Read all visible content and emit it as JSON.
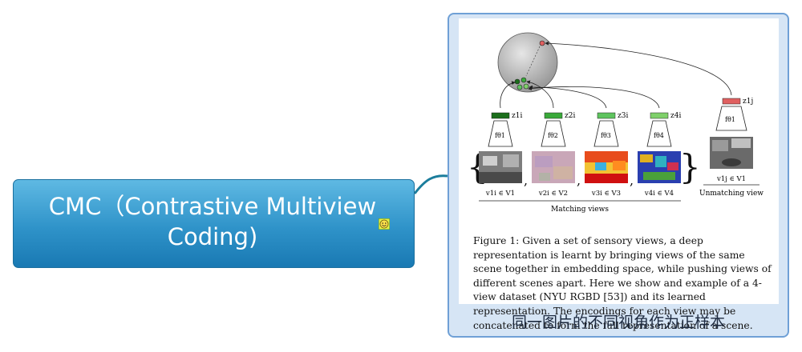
{
  "topic": {
    "title": "CMC（Contrastive Multiview Coding)",
    "icon": "smiley-icon"
  },
  "callout": {
    "label": "同一图片的不同视角作为正样本",
    "figure": {
      "encoders": [
        "fθ1",
        "fθ2",
        "fθ3",
        "fθ4",
        "fθ1"
      ],
      "codes": [
        "z1i",
        "z2i",
        "z3i",
        "z4i",
        "z1j"
      ],
      "views": [
        "v1i ∈ V1",
        "v2i ∈ V2",
        "v3i ∈ V3",
        "v4i ∈ V4",
        "v1j ∈ V1"
      ],
      "matching_label": "Matching views",
      "unmatching_label": "Unmatching view",
      "caption": "Figure 1: Given a set of sensory views, a deep representation is learnt by bringing views of the same scene together in embedding space, while pushing views of different scenes apart. Here we show and example of a 4-view dataset (NYU RGBD [53]) and its learned representation. The encodings for each view may be concatenated to form the full representation of a scene."
    }
  },
  "colors": {
    "topic_top": "#5fb9e3",
    "topic_bottom": "#1979b3",
    "callout_border": "#6fa0d6",
    "callout_bg": "#d6e5f5",
    "code_dark_green": "#1b6e1b",
    "code_green": "#3aa93a",
    "code_light_green": "#7fd06a",
    "code_red": "#e06060"
  }
}
